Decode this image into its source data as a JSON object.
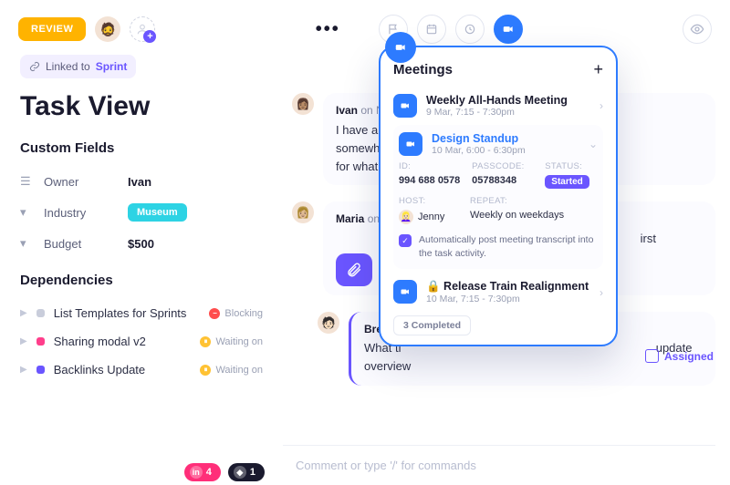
{
  "topbar": {
    "review_label": "REVIEW",
    "assignee_emoji": "🧔",
    "add_person_icon": "person"
  },
  "tools": {
    "flag": "⚑",
    "calendar": "cal",
    "clock": "clk",
    "video": "vid",
    "eye": "eye"
  },
  "left": {
    "linked_prefix": "Linked to",
    "linked_target": "Sprint",
    "title": "Task View",
    "custom_fields_heading": "Custom Fields",
    "fields": [
      {
        "icon": "owner",
        "label": "Owner",
        "value": "Ivan",
        "type": "text"
      },
      {
        "icon": "industry",
        "label": "Industry",
        "value": "Museum",
        "type": "tag"
      },
      {
        "icon": "budget",
        "label": "Budget",
        "value": "$500",
        "type": "text"
      }
    ],
    "dependencies_heading": "Dependencies",
    "deps": [
      {
        "color": "#c9cddb",
        "name": "List Templates for Sprints",
        "status_label": "Blocking",
        "status_color": "#ff4d4d",
        "status_glyph": "−"
      },
      {
        "color": "#ff3e8b",
        "name": "Sharing modal v2",
        "status_label": "Waiting on",
        "status_color": "#ffc233",
        "status_glyph": "⏸"
      },
      {
        "color": "#6a55ff",
        "name": "Backlinks Update",
        "status_label": "Waiting on",
        "status_color": "#ffc233",
        "status_glyph": "⏸"
      }
    ],
    "chips": [
      {
        "style": "pink",
        "glyph": "in",
        "count": "4"
      },
      {
        "style": "dark",
        "glyph": "◆",
        "count": "1"
      }
    ]
  },
  "conversation": {
    "messages": [
      {
        "emoji": "👩🏽",
        "name": "Ivan",
        "meta": "on N",
        "text_a": "I have a",
        "text_b": "somewhere",
        "text_c": "for what"
      },
      {
        "emoji": "👩🏼",
        "name": "Maria",
        "meta": "on",
        "text_b": "irst",
        "has_attach": true
      },
      {
        "emoji": "🧑🏻",
        "name": "Brendan",
        "text_a": "What ti",
        "text_b": "update",
        "text_c": "overview"
      }
    ],
    "assigned_label": "Assigned",
    "comment_placeholder": "Comment or type '/' for commands"
  },
  "popover": {
    "title": "Meetings",
    "meetings": [
      {
        "title": "Weekly All-Hands Meeting",
        "subtitle": "9 Mar, 7:15 - 7:30pm",
        "chevron": "›",
        "link": false
      },
      {
        "title": "Design Standup",
        "subtitle": "10 Mar, 6:00 - 6:30pm",
        "chevron": "⌄",
        "link": true,
        "expanded": true
      },
      {
        "title": "🔒 Release Train Realignment",
        "subtitle": "10 Mar, 7:15 - 7:30pm",
        "chevron": "›",
        "link": false
      }
    ],
    "details": {
      "id_label": "ID:",
      "id_value": "994 688 0578",
      "passcode_label": "PASSCODE:",
      "passcode_value": "05788348",
      "status_label": "STATUS:",
      "status_value": "Started",
      "host_label": "HOST:",
      "host_name": "Jenny",
      "host_emoji": "👱🏻‍♀️",
      "repeat_label": "REPEAT:",
      "repeat_value": "Weekly on weekdays",
      "auto_label": "Automatically post meeting transcript into the task activity."
    },
    "completed_label": "3 Completed"
  }
}
